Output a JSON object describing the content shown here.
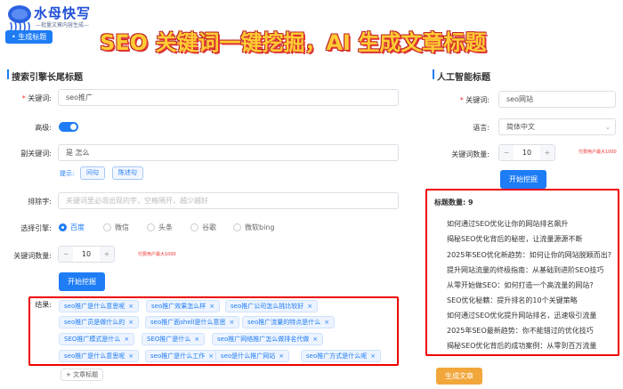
{
  "logo": {
    "title": "水母快写",
    "subtitle": "—批量文章内容生成—"
  },
  "banner": "SEO 关键词一键挖掘，AI 生成文章标题",
  "tab": "生成标题",
  "left": {
    "section_title": "搜索引擎长尾标题",
    "keyword_label": "关键词:",
    "keyword_value": "seo推广",
    "advanced_label": "高级:",
    "sub_keyword_label": "副关键词:",
    "sub_keyword_value": "是 怎么",
    "tip_label": "提示:",
    "tip_buttons": [
      "问句",
      "陈述句"
    ],
    "exclude_label": "排除字:",
    "exclude_placeholder": "关键词里必须出现的字，空格隔开，越少越好",
    "engine_label": "选择引擎:",
    "engines": [
      "百度",
      "微信",
      "头条",
      "谷歌",
      "微软bing"
    ],
    "count_label": "关键词数量:",
    "count_value": "10",
    "count_note": "付费用户最大1000",
    "start_button": "开始挖掘",
    "result_label": "结果:",
    "results": [
      "seo推广是什么意思呢",
      "seo推广效果怎么样",
      "seo推广公司怎么挑比较好",
      "seo推广员是做什么的",
      "seo推广面shell是什么意思",
      "seo推广流量的特点是什么",
      "SEO推广模式是什么",
      "SEO推广是什么",
      "seo推广网络推广怎么做排名代做",
      "seo推广是什么意思呢",
      "seo推广是什么工作",
      "seo是什么推广网站",
      "seo推广方式是什么呢"
    ],
    "add_tag": "+ 文章标题"
  },
  "right": {
    "section_title": "人工智能标题",
    "keyword_label": "关键词:",
    "keyword_value": "seo网站",
    "language_label": "语言:",
    "language_value": "简体中文",
    "count_label": "关键词数量:",
    "count_value": "10",
    "count_note": "付费用户最大1000",
    "start_button": "开始挖掘",
    "count_heading": "标题数量: 9",
    "titles": [
      "如何通过SEO优化让你的网站排名飙升",
      "揭秘SEO优化背后的秘密，让流量源源不断",
      "2025年SEO优化新趋势：如何让你的网站脱颖而出?",
      "提升网站流量的终极指南：从基础到进阶SEO技巧",
      "从零开始做SEO：如何打造一个高流量的网站?",
      "SEO优化秘籍：提升排名的10个关键策略",
      "如何通过SEO优化提升网站排名，迅速吸引流量",
      "2025年SEO最新趋势：你不能错过的优化技巧",
      "揭秘SEO优化背后的成功案例：从零到百万流量"
    ],
    "generate_button": "生成文章"
  },
  "colors": {
    "primary": "#1e7cf5",
    "highlight": "#e00000",
    "orange": "#f2a73b",
    "banner": "#ffcc33"
  }
}
